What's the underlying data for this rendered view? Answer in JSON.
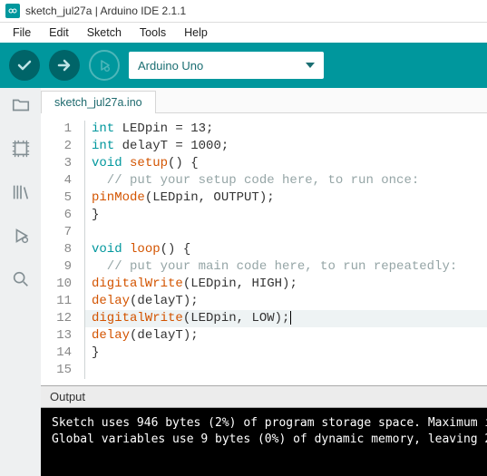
{
  "window": {
    "title": "sketch_jul27a | Arduino IDE 2.1.1"
  },
  "menu": {
    "file": "File",
    "edit": "Edit",
    "sketch": "Sketch",
    "tools": "Tools",
    "help": "Help"
  },
  "board": {
    "selected": "Arduino Uno"
  },
  "tab": {
    "name": "sketch_jul27a.ino"
  },
  "code": {
    "lines": [
      [
        {
          "t": "int ",
          "c": "tok-type"
        },
        {
          "t": "LEDpin = ",
          "c": ""
        },
        {
          "t": "13",
          "c": "tok-num"
        },
        {
          "t": ";",
          "c": ""
        }
      ],
      [
        {
          "t": "int ",
          "c": "tok-type"
        },
        {
          "t": "delayT = ",
          "c": ""
        },
        {
          "t": "1000",
          "c": "tok-num"
        },
        {
          "t": ";",
          "c": ""
        }
      ],
      [
        {
          "t": "void ",
          "c": "tok-type"
        },
        {
          "t": "setup",
          "c": "tok-fn"
        },
        {
          "t": "() {",
          "c": ""
        }
      ],
      [
        {
          "t": "  // put your setup code here, to run once:",
          "c": "tok-comment"
        }
      ],
      [
        {
          "t": "pinMode",
          "c": "tok-fn"
        },
        {
          "t": "(LEDpin, OUTPUT);",
          "c": ""
        }
      ],
      [
        {
          "t": "}",
          "c": ""
        }
      ],
      [],
      [
        {
          "t": "void ",
          "c": "tok-type"
        },
        {
          "t": "loop",
          "c": "tok-fn"
        },
        {
          "t": "() {",
          "c": ""
        }
      ],
      [
        {
          "t": "  // put your main code here, to run repeatedly:",
          "c": "tok-comment"
        }
      ],
      [
        {
          "t": "digitalWrite",
          "c": "tok-fn"
        },
        {
          "t": "(LEDpin, HIGH);",
          "c": ""
        }
      ],
      [
        {
          "t": "delay",
          "c": "tok-fn"
        },
        {
          "t": "(delayT);",
          "c": ""
        }
      ],
      [
        {
          "t": "digitalWrite",
          "c": "tok-fn"
        },
        {
          "t": "(LEDpin, LOW);",
          "c": ""
        }
      ],
      [
        {
          "t": "delay",
          "c": "tok-fn"
        },
        {
          "t": "(delayT);",
          "c": ""
        }
      ],
      [
        {
          "t": "}",
          "c": ""
        }
      ],
      []
    ],
    "highlight_line": 12,
    "cursor_line": 12
  },
  "output": {
    "label": "Output",
    "lines": [
      "Sketch uses 946 bytes (2%) of program storage space. Maximum i",
      "Global variables use 9 bytes (0%) of dynamic memory, leaving 2"
    ]
  }
}
